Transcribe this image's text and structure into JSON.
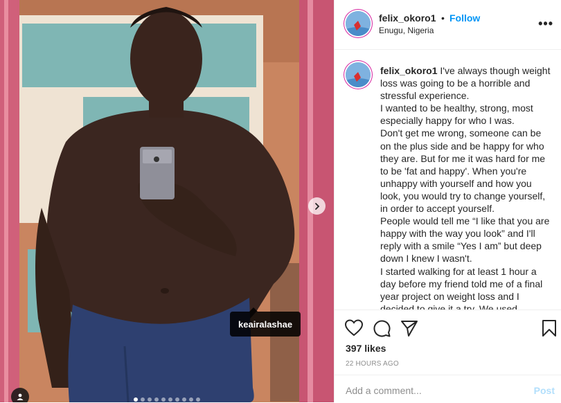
{
  "post": {
    "photo_tag_user": "keairalashae",
    "carousel_dot_count": 10,
    "carousel_active_index": 0
  },
  "header": {
    "username": "felix_okoro1",
    "separator": "•",
    "follow_label": "Follow",
    "location": "Enugu, Nigeria",
    "more_label": "•••"
  },
  "caption": {
    "username": "felix_okoro1",
    "lines": [
      "I've always though weight loss was going to be a horrible and stressful experience.",
      "I wanted to be healthy, strong, most especially happy for who I was.",
      "Don't get me wrong, someone can be on the plus side and be happy for who they are. But for me it was hard for me to be 'fat and happy'. When you're unhappy with yourself and how you look, you would try to change yourself, in order to accept yourself.",
      "People would tell me “I like that you are happy with the way you look” and I'll reply with a smile “Yes I am” but deep down I knew I wasn't.",
      "I started walking for at least 1 hour a day before my friend told me of a final year project on weight loss and I decided to give it a try. We used"
    ]
  },
  "stats": {
    "likes": "397 likes",
    "timestamp": "22 HOURS AGO"
  },
  "comment": {
    "placeholder": "Add a comment...",
    "post_label": "Post"
  },
  "colors": {
    "follow": "#0095f6",
    "post_disabled": "#b2dffc",
    "avatar_ring": "#d6249f",
    "muted": "#8e8e8e"
  },
  "icons": [
    "heart-icon",
    "comment-icon",
    "share-icon",
    "bookmark-icon",
    "chevron-right-icon",
    "user-tag-icon",
    "more-icon"
  ]
}
